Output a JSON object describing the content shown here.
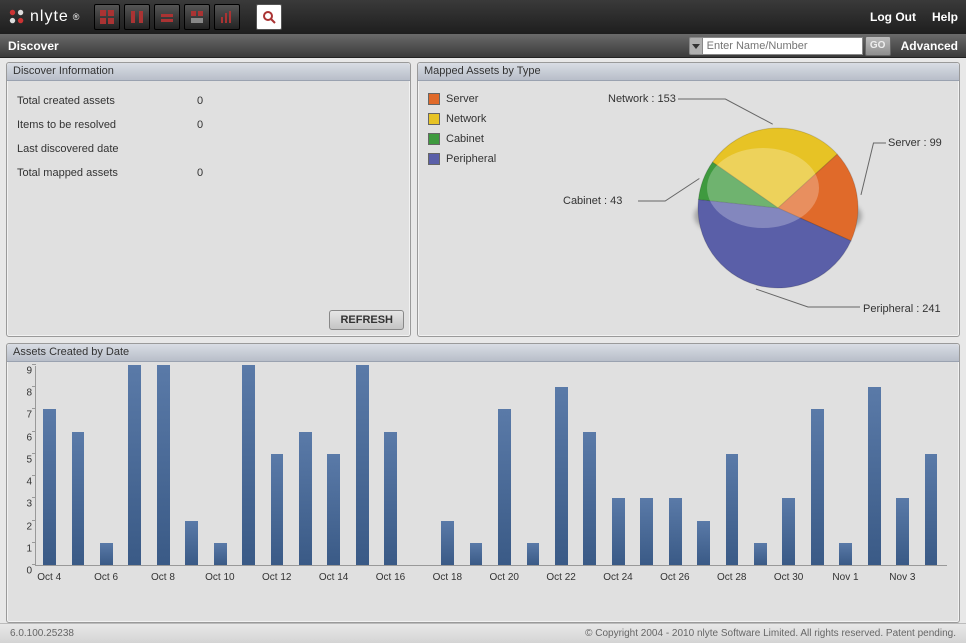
{
  "header": {
    "brand": "nlyte",
    "links": {
      "logout": "Log Out",
      "help": "Help"
    }
  },
  "toolbar": {
    "page": "Discover",
    "search_placeholder": "Enter Name/Number",
    "go": "GO",
    "advanced": "Advanced"
  },
  "discover_info": {
    "title": "Discover Information",
    "rows": [
      {
        "label": "Total created assets",
        "value": "0"
      },
      {
        "label": "Items to be resolved",
        "value": "0"
      },
      {
        "label": "Last discovered date",
        "value": ""
      },
      {
        "label": "Total mapped assets",
        "value": "0"
      }
    ],
    "refresh": "REFRESH"
  },
  "mapped_assets": {
    "title": "Mapped Assets by Type",
    "legend": [
      {
        "label": "Server",
        "color": "#e06a2a"
      },
      {
        "label": "Network",
        "color": "#e7c325"
      },
      {
        "label": "Cabinet",
        "color": "#3f9a3f"
      },
      {
        "label": "Peripheral",
        "color": "#5a5fa8"
      }
    ],
    "callouts": {
      "network": "Network : 153",
      "server": "Server : 99",
      "cabinet": "Cabinet : 43",
      "peripheral": "Peripheral : 241"
    }
  },
  "bar_panel": {
    "title": "Assets Created by Date"
  },
  "footer": {
    "version": "6.0.100.25238",
    "copyright": "© Copyright 2004 - 2010 nlyte Software Limited. All rights reserved. Patent pending."
  },
  "chart_data": [
    {
      "type": "pie",
      "title": "Mapped Assets by Type",
      "series": [
        {
          "name": "Server",
          "value": 99,
          "color": "#e06a2a"
        },
        {
          "name": "Network",
          "value": 153,
          "color": "#e7c325"
        },
        {
          "name": "Cabinet",
          "value": 43,
          "color": "#3f9a3f"
        },
        {
          "name": "Peripheral",
          "value": 241,
          "color": "#5a5fa8"
        }
      ]
    },
    {
      "type": "bar",
      "title": "Assets Created by Date",
      "ylabel": "",
      "xlabel": "",
      "ylim": [
        0,
        9
      ],
      "categories": [
        "Oct 4",
        "Oct 5",
        "Oct 6",
        "Oct 7",
        "Oct 8",
        "Oct 9",
        "Oct 10",
        "Oct 11",
        "Oct 12",
        "Oct 13",
        "Oct 14",
        "Oct 15",
        "Oct 16",
        "Oct 17",
        "Oct 18",
        "Oct 19",
        "Oct 20",
        "Oct 21",
        "Oct 22",
        "Oct 23",
        "Oct 24",
        "Oct 25",
        "Oct 26",
        "Oct 27",
        "Oct 28",
        "Oct 29",
        "Oct 30",
        "Oct 31",
        "Nov 1",
        "Nov 2",
        "Nov 3",
        "Nov 4"
      ],
      "x_tick_labels": [
        "Oct 4",
        "Oct 6",
        "Oct 8",
        "Oct 10",
        "Oct 12",
        "Oct 14",
        "Oct 16",
        "Oct 18",
        "Oct 20",
        "Oct 22",
        "Oct 24",
        "Oct 26",
        "Oct 28",
        "Oct 30",
        "Nov 1",
        "Nov 3"
      ],
      "values": [
        7,
        6,
        1,
        9,
        9,
        2,
        1,
        9,
        5,
        6,
        5,
        9,
        6,
        0,
        2,
        1,
        7,
        1,
        8,
        6,
        3,
        3,
        3,
        2,
        5,
        1,
        3,
        7,
        1,
        8,
        3,
        5
      ]
    }
  ]
}
